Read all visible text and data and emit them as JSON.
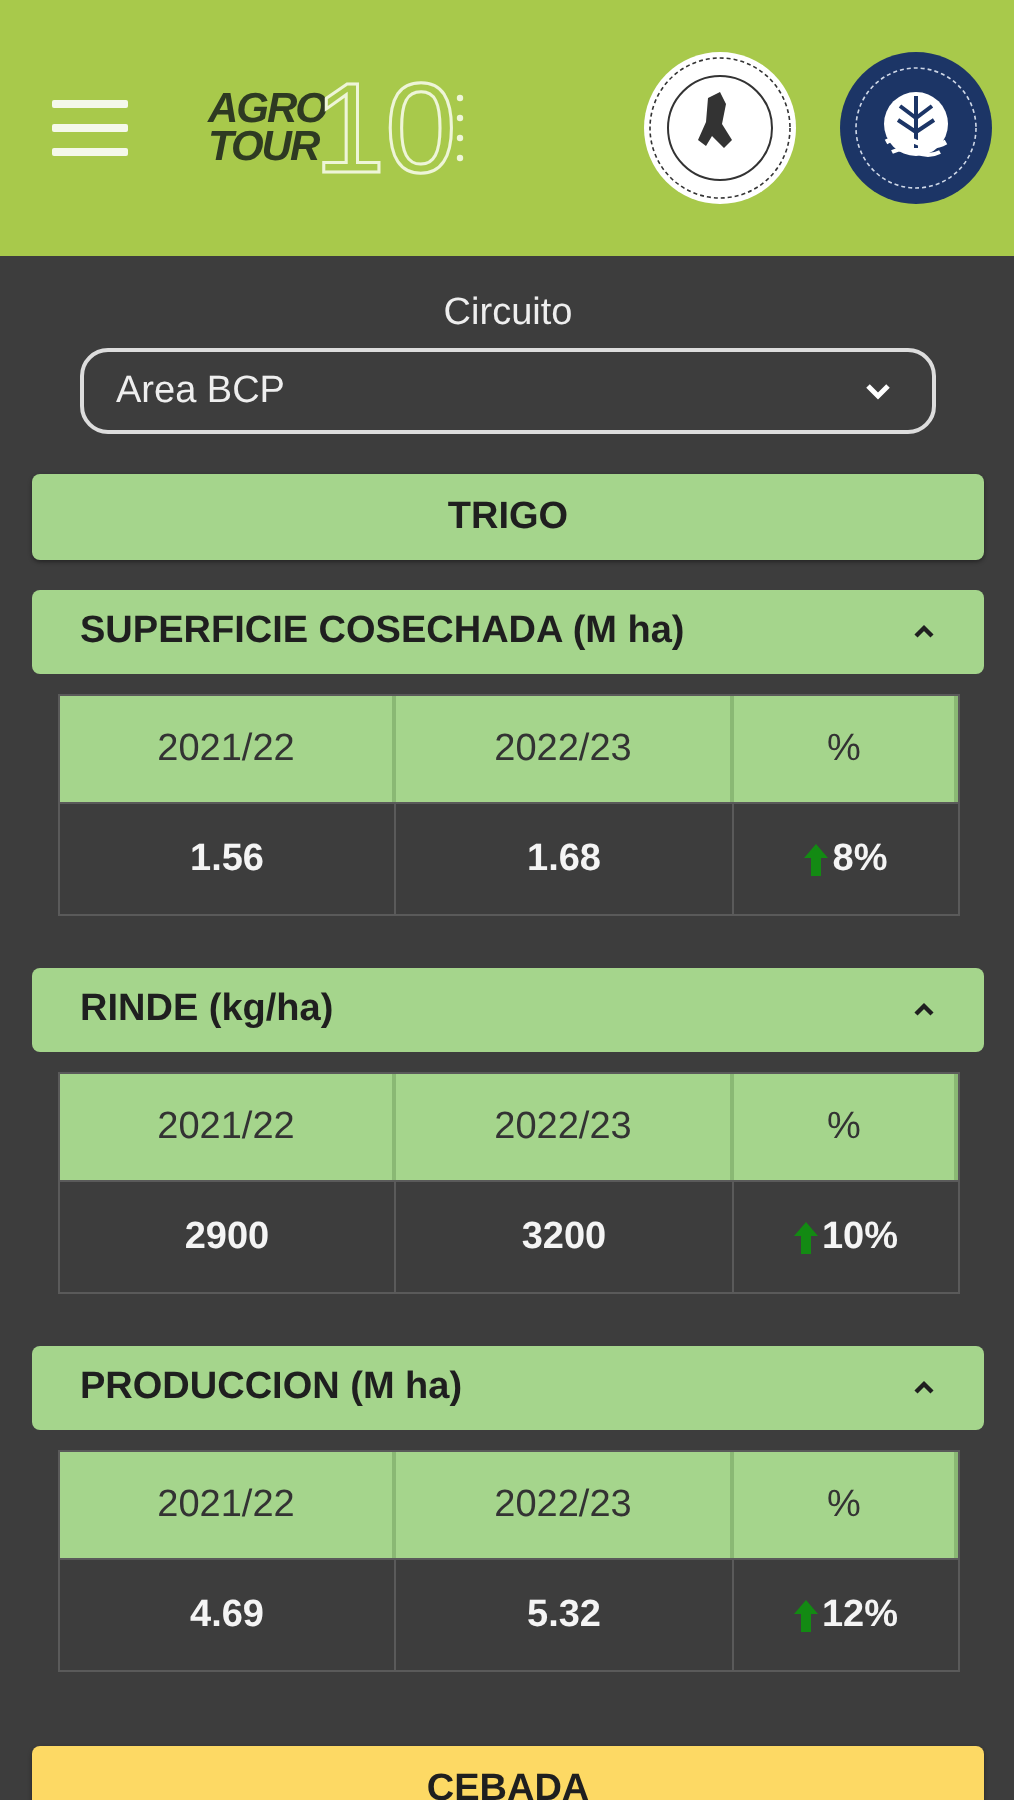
{
  "header": {
    "logo": {
      "line_1": "AGRO",
      "line_2": "TOUR",
      "number": "10"
    }
  },
  "circuit": {
    "label": "Circuito",
    "value": "Area BCP"
  },
  "crops": [
    {
      "name": "TRIGO",
      "color": "#a5d58c",
      "sections": [
        {
          "title": "SUPERFICIE COSECHADA (M ha)",
          "expanded": true,
          "columns": [
            "2021/22",
            "2022/23",
            "%"
          ],
          "values": [
            "1.56",
            "1.68"
          ],
          "change": {
            "rising": true,
            "text": "8%"
          }
        },
        {
          "title": "RINDE (kg/ha)",
          "expanded": true,
          "columns": [
            "2021/22",
            "2022/23",
            "%"
          ],
          "values": [
            "2900",
            "3200"
          ],
          "change": {
            "rising": true,
            "text": "10%"
          }
        },
        {
          "title": "PRODUCCION (M ha)",
          "expanded": true,
          "columns": [
            "2021/22",
            "2022/23",
            "%"
          ],
          "values": [
            "4.69",
            "5.32"
          ],
          "change": {
            "rising": true,
            "text": "12%"
          }
        }
      ]
    },
    {
      "name": "CEBADA",
      "color": "#fdd964"
    }
  ]
}
